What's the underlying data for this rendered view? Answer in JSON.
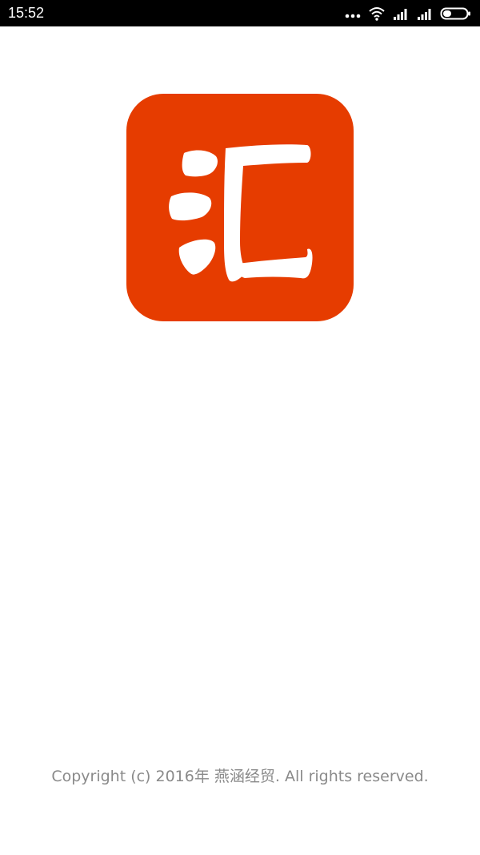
{
  "status_bar": {
    "time": "15:52",
    "icons": [
      "more-dots-icon",
      "wifi-icon",
      "signal-icon",
      "signal-icon",
      "battery-icon"
    ],
    "background": "#000000"
  },
  "logo": {
    "text": "汇",
    "background_color": "#e63c00",
    "glyph_color": "#ffffff"
  },
  "footer": {
    "copyright": "Copyright (c) 2016年  燕涵经贸. All rights reserved."
  },
  "colors": {
    "page_background": "#ffffff",
    "footer_text": "#8a8a8a"
  }
}
